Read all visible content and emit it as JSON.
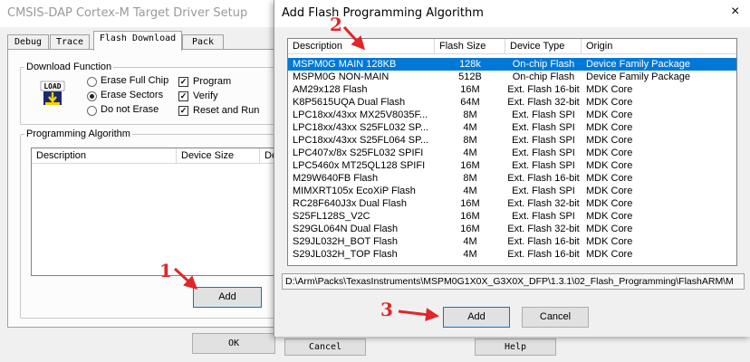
{
  "background_dialog": {
    "title": "CMSIS-DAP Cortex-M Target Driver Setup",
    "tabs": [
      "Debug",
      "Trace",
      "Flash Download",
      "Pack"
    ],
    "active_tab": "Flash Download",
    "download_function": {
      "legend": "Download Function",
      "icon": "LOAD",
      "options": [
        "Erase Full Chip",
        "Erase Sectors",
        "Do not Erase"
      ],
      "selected": "Erase Sectors",
      "checks": [
        {
          "label": "Program",
          "checked": true
        },
        {
          "label": "Verify",
          "checked": true
        },
        {
          "label": "Reset and Run",
          "checked": true
        }
      ]
    },
    "programming_algorithm": {
      "legend": "Programming Algorithm",
      "columns": [
        "Description",
        "Device Size",
        "Dev"
      ]
    },
    "buttons": {
      "add": "Add",
      "ok": "OK",
      "cancel": "Cancel",
      "help": "Help"
    }
  },
  "overlay_dialog": {
    "title": "Add Flash Programming Algorithm",
    "close_glyph": "×",
    "columns": [
      "Description",
      "Flash Size",
      "Device Type",
      "Origin"
    ],
    "rows": [
      {
        "description": "MSPM0G MAIN 128KB",
        "flash_size": "128k",
        "device_type": "On-chip Flash",
        "origin": "Device Family Package",
        "selected": true
      },
      {
        "description": "MSPM0G NON-MAIN",
        "flash_size": "512B",
        "device_type": "On-chip Flash",
        "origin": "Device Family Package"
      },
      {
        "description": "AM29x128 Flash",
        "flash_size": "16M",
        "device_type": "Ext. Flash 16-bit",
        "origin": "MDK Core"
      },
      {
        "description": "K8P5615UQA Dual Flash",
        "flash_size": "64M",
        "device_type": "Ext. Flash 32-bit",
        "origin": "MDK Core"
      },
      {
        "description": "LPC18xx/43xx MX25V8035F...",
        "flash_size": "8M",
        "device_type": "Ext. Flash SPI",
        "origin": "MDK Core"
      },
      {
        "description": "LPC18xx/43xx S25FL032 SP...",
        "flash_size": "4M",
        "device_type": "Ext. Flash SPI",
        "origin": "MDK Core"
      },
      {
        "description": "LPC18xx/43xx S25FL064 SP...",
        "flash_size": "8M",
        "device_type": "Ext. Flash SPI",
        "origin": "MDK Core"
      },
      {
        "description": "LPC407x/8x S25FL032 SPIFI",
        "flash_size": "4M",
        "device_type": "Ext. Flash SPI",
        "origin": "MDK Core"
      },
      {
        "description": "LPC5460x MT25QL128 SPIFI",
        "flash_size": "16M",
        "device_type": "Ext. Flash SPI",
        "origin": "MDK Core"
      },
      {
        "description": "M29W640FB Flash",
        "flash_size": "8M",
        "device_type": "Ext. Flash 16-bit",
        "origin": "MDK Core"
      },
      {
        "description": "MIMXRT105x EcoXiP Flash",
        "flash_size": "4M",
        "device_type": "Ext. Flash SPI",
        "origin": "MDK Core"
      },
      {
        "description": "RC28F640J3x Dual Flash",
        "flash_size": "16M",
        "device_type": "Ext. Flash 32-bit",
        "origin": "MDK Core"
      },
      {
        "description": "S25FL128S_V2C",
        "flash_size": "16M",
        "device_type": "Ext. Flash SPI",
        "origin": "MDK Core"
      },
      {
        "description": "S29GL064N Dual Flash",
        "flash_size": "16M",
        "device_type": "Ext. Flash 32-bit",
        "origin": "MDK Core"
      },
      {
        "description": "S29JL032H_BOT Flash",
        "flash_size": "4M",
        "device_type": "Ext. Flash 16-bit",
        "origin": "MDK Core"
      },
      {
        "description": "S29JL032H_TOP Flash",
        "flash_size": "4M",
        "device_type": "Ext. Flash 16-bit",
        "origin": "MDK Core"
      }
    ],
    "path": "D:\\Arm\\Packs\\TexasInstruments\\MSPM0G1X0X_G3X0X_DFP\\1.3.1\\02_Flash_Programming\\FlashARM\\M",
    "buttons": {
      "add": "Add",
      "cancel": "Cancel"
    }
  },
  "annotations": {
    "step1": "1",
    "step2": "2",
    "step3": "3",
    "color": "#e0262b"
  },
  "colors": {
    "selection": "#0078d7",
    "focus_border": "#0078d7"
  }
}
